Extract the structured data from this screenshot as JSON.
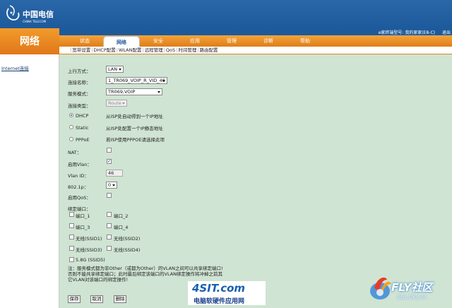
{
  "brand": {
    "name": "中国电信",
    "sub": "CHINA TELECOM"
  },
  "page_title": "网络",
  "gateway_info": "e家终端型号: 我的家家(E8-C)",
  "exit_label": "退出",
  "nav": [
    {
      "label": "状态",
      "active": false
    },
    {
      "label": "网络",
      "active": true
    },
    {
      "label": "安全",
      "active": false
    },
    {
      "label": "应用",
      "active": false
    },
    {
      "label": "管理",
      "active": false
    },
    {
      "label": "诊断",
      "active": false
    },
    {
      "label": "帮助",
      "active": false
    }
  ],
  "subnav": [
    "宽带设置",
    "DHCP配置",
    "WLAN配置",
    "远程管理",
    "QoS",
    "时间管理",
    "路由配置"
  ],
  "sidebar": {
    "link": "Internet连接"
  },
  "form": {
    "uplink_label": "上行方式：",
    "uplink_value": "LAN",
    "conn_name_label": "连接名称：",
    "conn_name_value": "1_TR069_VOIP_R_VID_46",
    "service_mode_label": "服务模式：",
    "service_mode_value": "TR069,VOIP",
    "conn_type_label": "连接类型：",
    "conn_type_value": "Route",
    "dhcp_label": "DHCP",
    "dhcp_desc": "从ISP处自动得到一个IP地址",
    "static_label": "Static",
    "static_desc": "从ISP处配置一个IP静态地址",
    "pppoe_label": "PPPoE",
    "pppoe_desc": "若ISP使用PPPOE请选择此项",
    "nat_label": "NAT：",
    "vlan_enable_label": "启用Vlan：",
    "vlan_enable_mark": "✓",
    "vlan_id_label": "Vlan ID：",
    "vlan_id_value": "46",
    "dot1p_label": "802.1p：",
    "dot1p_value": "0",
    "qos_label": "启用QoS：",
    "bind_port_label": "绑定端口："
  },
  "ports": [
    "端口_1",
    "端口_2",
    "端口_3",
    "端口_4",
    "无线(SSID1)",
    "无线(SSID2)",
    "无线(SSID3)",
    "无线(SSID4)",
    "5.8G (SSID5)"
  ],
  "notes": [
    "注：服务模式都为非Other（或都为Other）的VLAN之间可以共享绑定端口!",
    "否则不能共享绑定端口；此时最后绑定该端口的VLAN绑定操作将冲掉之前其",
    "它VLAN对该端口的绑定操作!"
  ],
  "buttons": {
    "save": "保存",
    "cancel": "取消",
    "delete": "删除"
  },
  "watermarks": {
    "site1_top": "4SIT.com",
    "site1_bottom": "电脑软硬件应用网",
    "site2_top": "FLY社区",
    "site2_bottom": "bbs.0xy.cn"
  },
  "colors": {
    "brand_blue": "#1d5a9c",
    "nav_orange": "#e07d18",
    "content_bg": "#cfe4d2"
  }
}
